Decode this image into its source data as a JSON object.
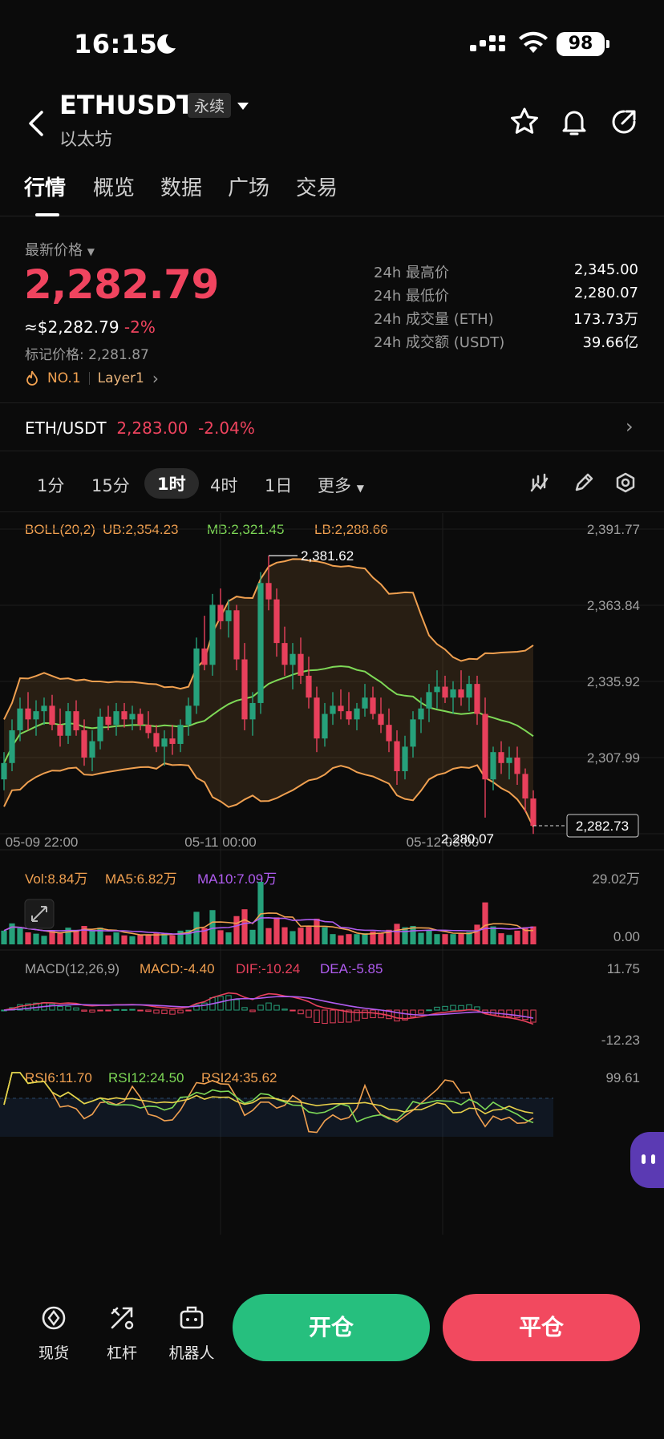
{
  "status_bar": {
    "time": "16:15",
    "battery": "98"
  },
  "header": {
    "symbol": "ETHUSDT",
    "contract_type": "永续",
    "name": "以太坊"
  },
  "tabs": [
    {
      "label": "行情",
      "active": true
    },
    {
      "label": "概览"
    },
    {
      "label": "数据"
    },
    {
      "label": "广场"
    },
    {
      "label": "交易"
    }
  ],
  "ticker": {
    "latest_label": "最新价格",
    "price": "2,282.79",
    "usd_price": "≈$2,282.79",
    "change": "-2%",
    "mark_price": "标记价格: 2,281.87",
    "rank": "NO.1",
    "category": "Layer1",
    "stats": [
      {
        "label": "24h 最高价",
        "value": "2,345.00"
      },
      {
        "label": "24h 最低价",
        "value": "2,280.07"
      },
      {
        "label": "24h 成交量 (ETH)",
        "value": "173.73万"
      },
      {
        "label": "24h 成交额 (USDT)",
        "value": "39.66亿"
      }
    ],
    "spot_pair": "ETH/USDT",
    "spot_price": "2,283.00",
    "spot_change": "-2.04%"
  },
  "intervals": [
    {
      "label": "1分"
    },
    {
      "label": "15分"
    },
    {
      "label": "1时",
      "active": true
    },
    {
      "label": "4时"
    },
    {
      "label": "1日"
    },
    {
      "label": "更多"
    }
  ],
  "chart_data": {
    "type": "candlestick",
    "boll": {
      "label": "BOLL(20,2)",
      "ub": "UB:2,354.23",
      "mb": "MB:2,321.45",
      "lb": "LB:2,288.66"
    },
    "y_ticks": [
      "2,391.77",
      "2,363.84",
      "2,335.92",
      "2,307.99",
      "2,280.07"
    ],
    "ylim": [
      2280.07,
      2391.77
    ],
    "x_ticks": [
      "05-09 22:00",
      "05-11 00:00",
      "05-12 03:00"
    ],
    "high_label": "2,381.62",
    "low_label": "2,280.07",
    "last_price_tag": "2,282.73",
    "candles": [
      [
        2300,
        2310,
        2296,
        2306
      ],
      [
        2306,
        2322,
        2303,
        2318
      ],
      [
        2318,
        2330,
        2314,
        2326
      ],
      [
        2326,
        2332,
        2318,
        2322
      ],
      [
        2322,
        2329,
        2316,
        2325
      ],
      [
        2325,
        2330,
        2320,
        2327
      ],
      [
        2327,
        2331,
        2318,
        2320
      ],
      [
        2320,
        2326,
        2312,
        2316
      ],
      [
        2316,
        2328,
        2313,
        2325
      ],
      [
        2325,
        2329,
        2316,
        2318
      ],
      [
        2318,
        2322,
        2305,
        2308
      ],
      [
        2308,
        2318,
        2303,
        2314
      ],
      [
        2314,
        2326,
        2311,
        2323
      ],
      [
        2323,
        2327,
        2318,
        2320
      ],
      [
        2320,
        2328,
        2316,
        2325
      ],
      [
        2325,
        2328,
        2319,
        2322
      ],
      [
        2322,
        2327,
        2318,
        2324
      ],
      [
        2324,
        2326,
        2318,
        2320
      ],
      [
        2320,
        2325,
        2315,
        2317
      ],
      [
        2317,
        2320,
        2310,
        2312
      ],
      [
        2312,
        2318,
        2305,
        2315
      ],
      [
        2315,
        2320,
        2309,
        2313
      ],
      [
        2313,
        2322,
        2310,
        2320
      ],
      [
        2320,
        2330,
        2316,
        2327
      ],
      [
        2327,
        2352,
        2324,
        2348
      ],
      [
        2348,
        2360,
        2340,
        2342
      ],
      [
        2342,
        2368,
        2338,
        2364
      ],
      [
        2364,
        2370,
        2355,
        2358
      ],
      [
        2358,
        2366,
        2352,
        2362
      ],
      [
        2362,
        2364,
        2340,
        2344
      ],
      [
        2344,
        2350,
        2318,
        2322
      ],
      [
        2322,
        2332,
        2316,
        2328
      ],
      [
        2328,
        2376,
        2324,
        2372
      ],
      [
        2372,
        2382,
        2362,
        2366
      ],
      [
        2366,
        2370,
        2345,
        2350
      ],
      [
        2350,
        2356,
        2338,
        2342
      ],
      [
        2342,
        2350,
        2333,
        2346
      ],
      [
        2346,
        2352,
        2335,
        2338
      ],
      [
        2338,
        2345,
        2326,
        2330
      ],
      [
        2330,
        2334,
        2310,
        2315
      ],
      [
        2315,
        2328,
        2312,
        2324
      ],
      [
        2324,
        2332,
        2320,
        2327
      ],
      [
        2327,
        2333,
        2322,
        2325
      ],
      [
        2325,
        2332,
        2320,
        2322
      ],
      [
        2322,
        2328,
        2318,
        2326
      ],
      [
        2326,
        2335,
        2323,
        2330
      ],
      [
        2330,
        2334,
        2322,
        2324
      ],
      [
        2324,
        2330,
        2317,
        2320
      ],
      [
        2320,
        2326,
        2310,
        2314
      ],
      [
        2314,
        2318,
        2298,
        2303
      ],
      [
        2303,
        2316,
        2300,
        2312
      ],
      [
        2312,
        2325,
        2308,
        2322
      ],
      [
        2322,
        2330,
        2317,
        2326
      ],
      [
        2326,
        2335,
        2321,
        2332
      ],
      [
        2332,
        2340,
        2326,
        2334
      ],
      [
        2334,
        2338,
        2328,
        2330
      ],
      [
        2330,
        2336,
        2324,
        2333
      ],
      [
        2333,
        2340,
        2327,
        2330
      ],
      [
        2330,
        2338,
        2325,
        2335
      ],
      [
        2335,
        2338,
        2320,
        2324
      ],
      [
        2324,
        2330,
        2286,
        2300
      ],
      [
        2300,
        2312,
        2296,
        2310
      ],
      [
        2310,
        2314,
        2302,
        2306
      ],
      [
        2306,
        2312,
        2300,
        2308
      ],
      [
        2308,
        2312,
        2298,
        2302
      ],
      [
        2302,
        2304,
        2288,
        2293
      ],
      [
        2293,
        2296,
        2280,
        2283
      ]
    ],
    "volume": {
      "label": "Vol:8.84万",
      "ma5": "MA5:6.82万",
      "ma10": "MA10:7.09万",
      "max": "29.02万",
      "min": "0.00"
    },
    "macd": {
      "label": "MACD(12,26,9)",
      "macd": "MACD:-4.40",
      "dif": "DIF:-10.24",
      "dea": "DEA:-5.85",
      "max": "11.75",
      "min": "-12.23"
    },
    "rsi": {
      "rsi6": "RSI6:11.70",
      "rsi12": "RSI12:24.50",
      "rsi24": "RSI24:35.62",
      "max": "99.61"
    }
  },
  "bottom_bar": {
    "spot": "现货",
    "leverage": "杠杆",
    "robot": "机器人",
    "open": "开仓",
    "close": "平仓"
  },
  "colors": {
    "up": "#26a17b",
    "down": "#e8405c",
    "ub": "#f0a050",
    "mb": "#7ed957",
    "lb": "#f0a050"
  }
}
